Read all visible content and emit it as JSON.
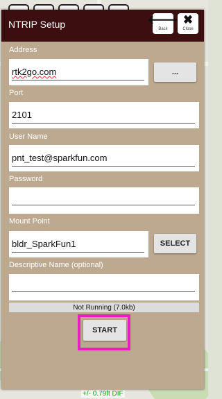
{
  "dialog": {
    "title": "NTRIP Setup",
    "back_label": "Back",
    "close_label": "Close",
    "back_icon": "arrow-left-icon",
    "close_icon": "close-x-icon"
  },
  "fields": {
    "address": {
      "label": "Address",
      "value": "rtk2go.com",
      "button": "..."
    },
    "port": {
      "label": "Port",
      "value": "2101"
    },
    "username": {
      "label": "User Name",
      "value": "pnt_test@sparkfun.com"
    },
    "password": {
      "label": "Password",
      "value": ""
    },
    "mountpoint": {
      "label": "Mount Point",
      "value": "bldr_SparkFun1",
      "button": "SELECT"
    },
    "description": {
      "label": "Descriptive Name (optional)",
      "value": ""
    }
  },
  "status": "Not Running (7.0kb)",
  "start_label": "START",
  "map_status": "+/- 0.79ft DIF",
  "colors": {
    "titlebar": "#3b0f0f",
    "panel": "#bda98f",
    "highlight": "#e81ec1",
    "map_status": "#13a313"
  }
}
